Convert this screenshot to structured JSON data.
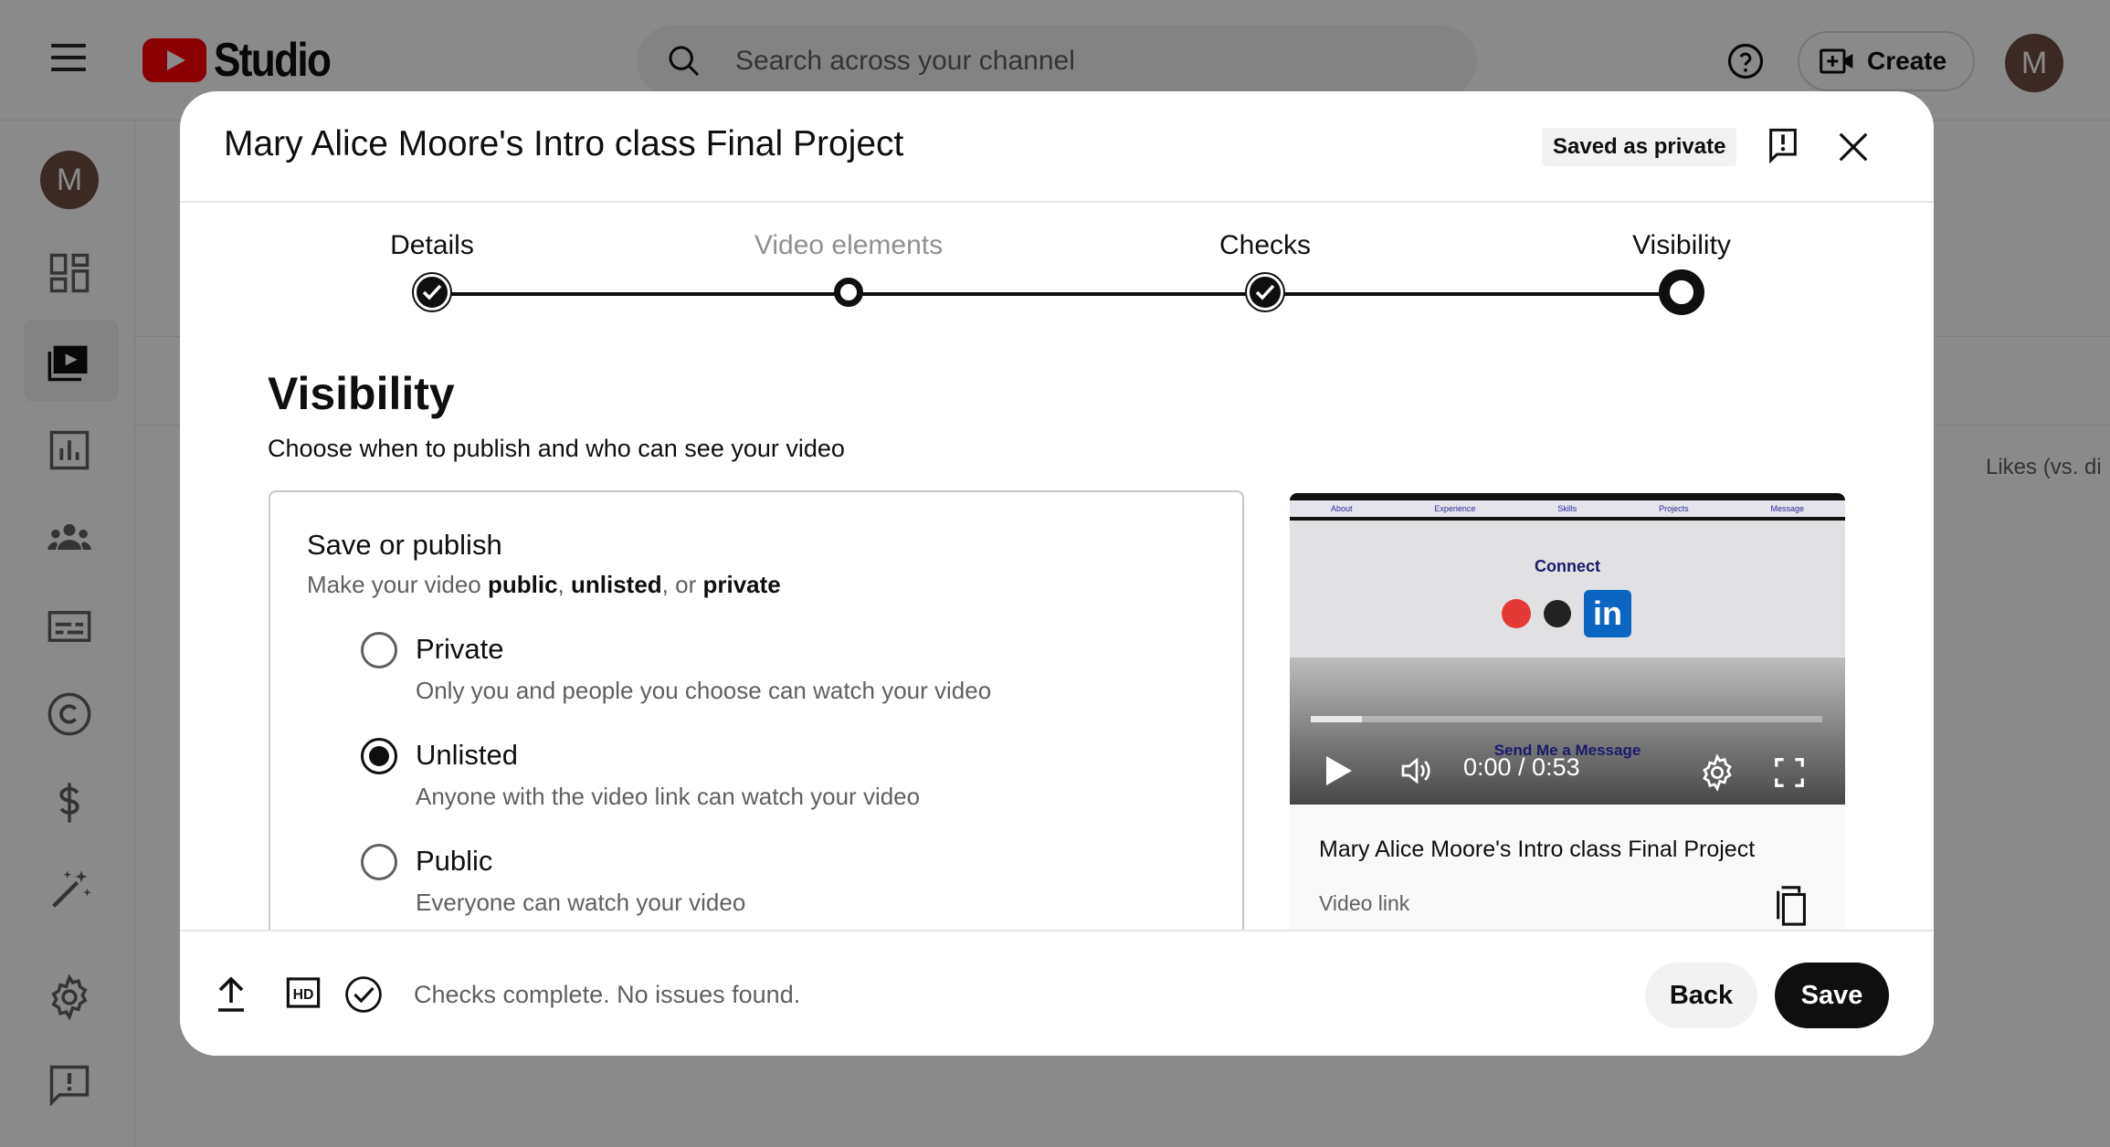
{
  "app": {
    "logo_text": "Studio",
    "search_placeholder": "Search across your channel",
    "create_label": "Create",
    "avatar_letter": "M",
    "likes_column": "Likes (vs. di"
  },
  "sidebar": {
    "avatar_letter": "M",
    "items": [
      {
        "icon": "dashboard-icon"
      },
      {
        "icon": "content-icon",
        "active": true
      },
      {
        "icon": "analytics-icon"
      },
      {
        "icon": "community-icon"
      },
      {
        "icon": "subtitles-icon"
      },
      {
        "icon": "copyright-icon"
      },
      {
        "icon": "earn-icon"
      },
      {
        "icon": "customization-icon"
      },
      {
        "icon": "settings-icon"
      },
      {
        "icon": "feedback-icon"
      }
    ]
  },
  "dialog": {
    "title": "Mary Alice Moore's Intro class Final Project",
    "saved_badge": "Saved as private",
    "steps": [
      {
        "label": "Details",
        "state": "done"
      },
      {
        "label": "Video elements",
        "state": "open"
      },
      {
        "label": "Checks",
        "state": "done"
      },
      {
        "label": "Visibility",
        "state": "current"
      }
    ],
    "section_title": "Visibility",
    "section_subtitle": "Choose when to publish and who can see your video",
    "card": {
      "title": "Save or publish",
      "sub_prefix": "Make your video ",
      "sub_public": "public",
      "sub_sep1": ", ",
      "sub_unlisted": "unlisted",
      "sub_sep2": ", or ",
      "sub_private": "private",
      "options": [
        {
          "label": "Private",
          "desc": "Only you and people you choose can watch your video",
          "checked": false
        },
        {
          "label": "Unlisted",
          "desc": "Anyone with the video link can watch your video",
          "checked": true
        },
        {
          "label": "Public",
          "desc": "Everyone can watch your video",
          "checked": false
        }
      ]
    },
    "preview": {
      "video_nav": [
        "About",
        "Experience",
        "Skills",
        "Projects",
        "Message"
      ],
      "video_connect": "Connect",
      "video_linkedin": "in",
      "video_message": "Send Me a Message",
      "time": "0:00 / 0:53",
      "progress_buffered": 0.1,
      "title": "Mary Alice Moore's Intro class Final Project",
      "link_label": "Video link"
    },
    "footer": {
      "status": "Checks complete. No issues found.",
      "back_label": "Back",
      "save_label": "Save"
    }
  }
}
